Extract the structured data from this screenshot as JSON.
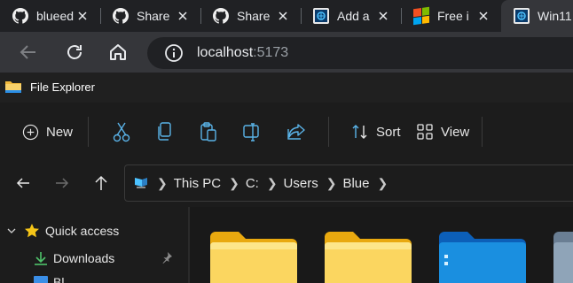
{
  "browser": {
    "tabs": [
      {
        "title": "blueed",
        "icon": "github-icon",
        "active": false
      },
      {
        "title": "Share",
        "icon": "github-icon",
        "active": false
      },
      {
        "title": "Share",
        "icon": "github-icon",
        "active": false
      },
      {
        "title": "Add a",
        "icon": "app-icon",
        "active": false
      },
      {
        "title": "Free i",
        "icon": "windows-logo-icon",
        "active": false
      },
      {
        "title": "Win11",
        "icon": "app-icon",
        "active": true
      }
    ],
    "url_host": "localhost",
    "url_port": ":5173"
  },
  "explorer": {
    "title": "File Explorer",
    "commands": {
      "new_label": "New",
      "sort_label": "Sort",
      "view_label": "View"
    },
    "breadcrumbs": [
      "This PC",
      "C:",
      "Users",
      "Blue"
    ],
    "nav": {
      "quick_access": "Quick access",
      "downloads": "Downloads",
      "third_item_partial": "Bl"
    }
  },
  "colors": {
    "accent": "#4cc2ff",
    "folder_yellow": "#f6c94a",
    "folder_blue": "#1a8fe0"
  }
}
